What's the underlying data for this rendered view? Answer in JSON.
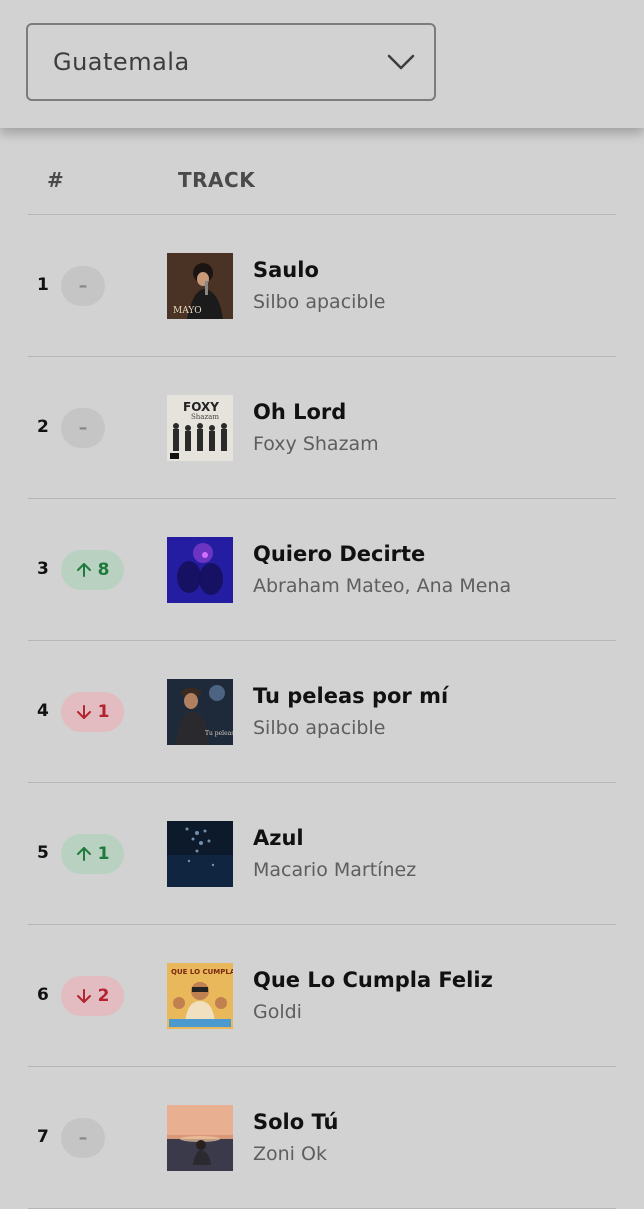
{
  "country_select": {
    "value": "Guatemala"
  },
  "list_header": {
    "rank_label": "#",
    "track_label": "TRACK"
  },
  "tracks": [
    {
      "rank": "1",
      "change": "same",
      "change_label": "–",
      "title": "Saulo",
      "artist": "Silbo apacible"
    },
    {
      "rank": "2",
      "change": "same",
      "change_label": "–",
      "title": "Oh Lord",
      "artist": "Foxy Shazam"
    },
    {
      "rank": "3",
      "change": "up",
      "change_label": "8",
      "title": "Quiero Decirte",
      "artist": "Abraham Mateo, Ana Mena"
    },
    {
      "rank": "4",
      "change": "down",
      "change_label": "1",
      "title": "Tu peleas por mí",
      "artist": "Silbo apacible"
    },
    {
      "rank": "5",
      "change": "up",
      "change_label": "1",
      "title": "Azul",
      "artist": "Macario Martínez"
    },
    {
      "rank": "6",
      "change": "down",
      "change_label": "2",
      "title": "Que Lo Cumpla Feliz",
      "artist": "Goldi"
    },
    {
      "rank": "7",
      "change": "same",
      "change_label": "–",
      "title": "Solo Tú",
      "artist": "Zoni Ok"
    }
  ],
  "colors": {
    "up": "#1f7a3c",
    "down": "#b3242f",
    "neutral": "#858585",
    "background": "#d2d2d2"
  }
}
